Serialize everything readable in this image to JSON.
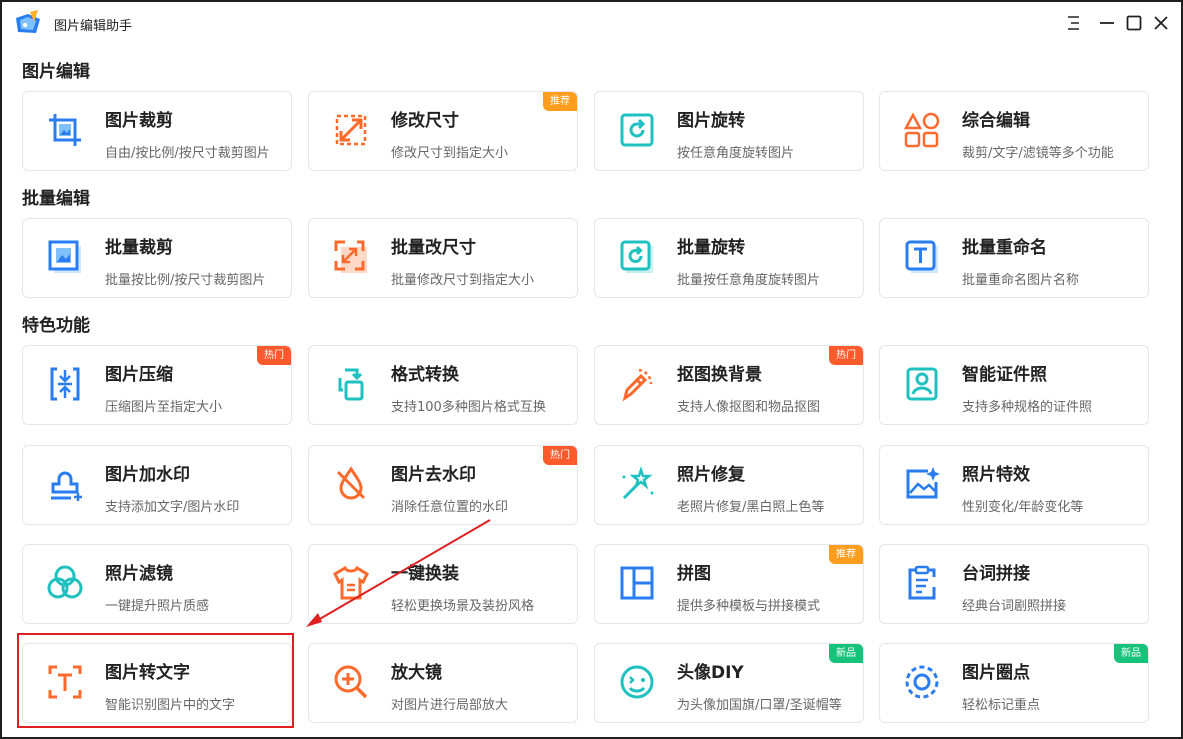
{
  "window": {
    "title": "图片编辑助手"
  },
  "sections": [
    {
      "title": "图片编辑"
    },
    {
      "title": "批量编辑"
    },
    {
      "title": "特色功能"
    }
  ],
  "cards": [
    {
      "title": "图片裁剪",
      "desc": "自由/按比例/按尺寸裁剪图片",
      "icon": "crop-icon",
      "badge": ""
    },
    {
      "title": "修改尺寸",
      "desc": "修改尺寸到指定大小",
      "icon": "resize-icon",
      "badge": "推荐"
    },
    {
      "title": "图片旋转",
      "desc": "按任意角度旋转图片",
      "icon": "rotate-icon",
      "badge": ""
    },
    {
      "title": "综合编辑",
      "desc": "裁剪/文字/滤镜等多个功能",
      "icon": "shapes-icon",
      "badge": ""
    },
    {
      "title": "批量裁剪",
      "desc": "批量按比例/按尺寸裁剪图片",
      "icon": "batch-crop-icon",
      "badge": ""
    },
    {
      "title": "批量改尺寸",
      "desc": "批量修改尺寸到指定大小",
      "icon": "batch-resize-icon",
      "badge": ""
    },
    {
      "title": "批量旋转",
      "desc": "批量按任意角度旋转图片",
      "icon": "batch-rotate-icon",
      "badge": ""
    },
    {
      "title": "批量重命名",
      "desc": "批量重命名图片名称",
      "icon": "batch-rename-icon",
      "badge": ""
    },
    {
      "title": "图片压缩",
      "desc": "压缩图片至指定大小",
      "icon": "compress-icon",
      "badge": "热门"
    },
    {
      "title": "格式转换",
      "desc": "支持100多种图片格式互换",
      "icon": "format-convert-icon",
      "badge": ""
    },
    {
      "title": "抠图换背景",
      "desc": "支持人像抠图和物品抠图",
      "icon": "cutout-pen-icon",
      "badge": "热门"
    },
    {
      "title": "智能证件照",
      "desc": "支持多种规格的证件照",
      "icon": "id-photo-icon",
      "badge": ""
    },
    {
      "title": "图片加水印",
      "desc": "支持添加文字/图片水印",
      "icon": "stamp-icon",
      "badge": ""
    },
    {
      "title": "图片去水印",
      "desc": "消除任意位置的水印",
      "icon": "no-drop-icon",
      "badge": "热门"
    },
    {
      "title": "照片修复",
      "desc": "老照片修复/黑白照上色等",
      "icon": "magic-wand-icon",
      "badge": ""
    },
    {
      "title": "照片特效",
      "desc": "性别变化/年龄变化等",
      "icon": "image-sparkle-icon",
      "badge": ""
    },
    {
      "title": "照片滤镜",
      "desc": "一键提升照片质感",
      "icon": "filter-circles-icon",
      "badge": ""
    },
    {
      "title": "一键换装",
      "desc": "轻松更换场景及装扮风格",
      "icon": "tshirt-icon",
      "badge": ""
    },
    {
      "title": "拼图",
      "desc": "提供多种模板与拼接模式",
      "icon": "collage-icon",
      "badge": "推荐"
    },
    {
      "title": "台词拼接",
      "desc": "经典台词剧照拼接",
      "icon": "clipboard-icon",
      "badge": ""
    },
    {
      "title": "图片转文字",
      "desc": "智能识别图片中的文字",
      "icon": "ocr-text-icon",
      "badge": ""
    },
    {
      "title": "放大镜",
      "desc": "对图片进行局部放大",
      "icon": "magnifier-icon",
      "badge": ""
    },
    {
      "title": "头像DIY",
      "desc": "为头像加国旗/口罩/圣诞帽等",
      "icon": "smiley-icon",
      "badge": "新品"
    },
    {
      "title": "图片圈点",
      "desc": "轻松标记重点",
      "icon": "dashed-circle-icon",
      "badge": "新品"
    }
  ],
  "colors": {
    "blue": "#2a7df0",
    "orange": "#ff6a2c",
    "teal": "#1fc0c0",
    "badge_orange": "#ff9d1f",
    "badge_red": "#ff5a2c",
    "badge_green": "#17c27a",
    "highlight_red": "#e02020"
  }
}
